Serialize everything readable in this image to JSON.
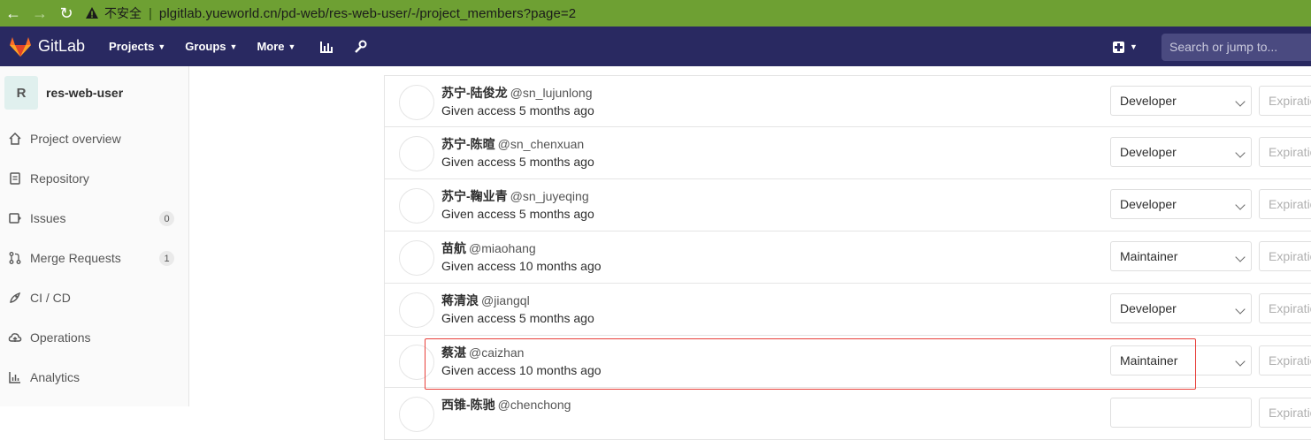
{
  "browser": {
    "insecure_label": "不安全",
    "url": "plgitlab.yueworld.cn/pd-web/res-web-user/-/project_members?page=2"
  },
  "header": {
    "brand": "GitLab",
    "nav": [
      {
        "label": "Projects"
      },
      {
        "label": "Groups"
      },
      {
        "label": "More"
      }
    ],
    "search_placeholder": "Search or jump to..."
  },
  "sidebar": {
    "project_initial": "R",
    "project_name": "res-web-user",
    "items": [
      {
        "label": "Project overview",
        "icon": "home-icon"
      },
      {
        "label": "Repository",
        "icon": "document-icon"
      },
      {
        "label": "Issues",
        "icon": "issues-icon",
        "count": "0"
      },
      {
        "label": "Merge Requests",
        "icon": "merge-request-icon",
        "count": "1"
      },
      {
        "label": "CI / CD",
        "icon": "rocket-icon"
      },
      {
        "label": "Operations",
        "icon": "cloud-icon"
      },
      {
        "label": "Analytics",
        "icon": "chart-icon"
      }
    ]
  },
  "members": [
    {
      "name": "苏宁-陆俊龙",
      "username": "@sn_lujunlong",
      "access": "Given access 5 months ago",
      "role": "Developer",
      "expiration": "Expiration date"
    },
    {
      "name": "苏宁-陈暄",
      "username": "@sn_chenxuan",
      "access": "Given access 5 months ago",
      "role": "Developer",
      "expiration": "Expiration date"
    },
    {
      "name": "苏宁-鞠业青",
      "username": "@sn_juyeqing",
      "access": "Given access 5 months ago",
      "role": "Developer",
      "expiration": "Expiration date"
    },
    {
      "name": "苗航",
      "username": "@miaohang",
      "access": "Given access 10 months ago",
      "role": "Maintainer",
      "expiration": "Expiration date"
    },
    {
      "name": "蒋清浪",
      "username": "@jiangql",
      "access": "Given access 5 months ago",
      "role": "Developer",
      "expiration": "Expiration date"
    },
    {
      "name": "蔡湛",
      "username": "@caizhan",
      "access": "Given access 10 months ago",
      "role": "Maintainer",
      "expiration": "Expiration date"
    },
    {
      "name": "西锥-陈驰",
      "username": "@chenchong",
      "access": "",
      "role": "",
      "expiration": "Expiration date"
    }
  ],
  "colors": {
    "browser_bar": "#6ea033",
    "header": "#292961",
    "highlight": "#e8403a"
  }
}
